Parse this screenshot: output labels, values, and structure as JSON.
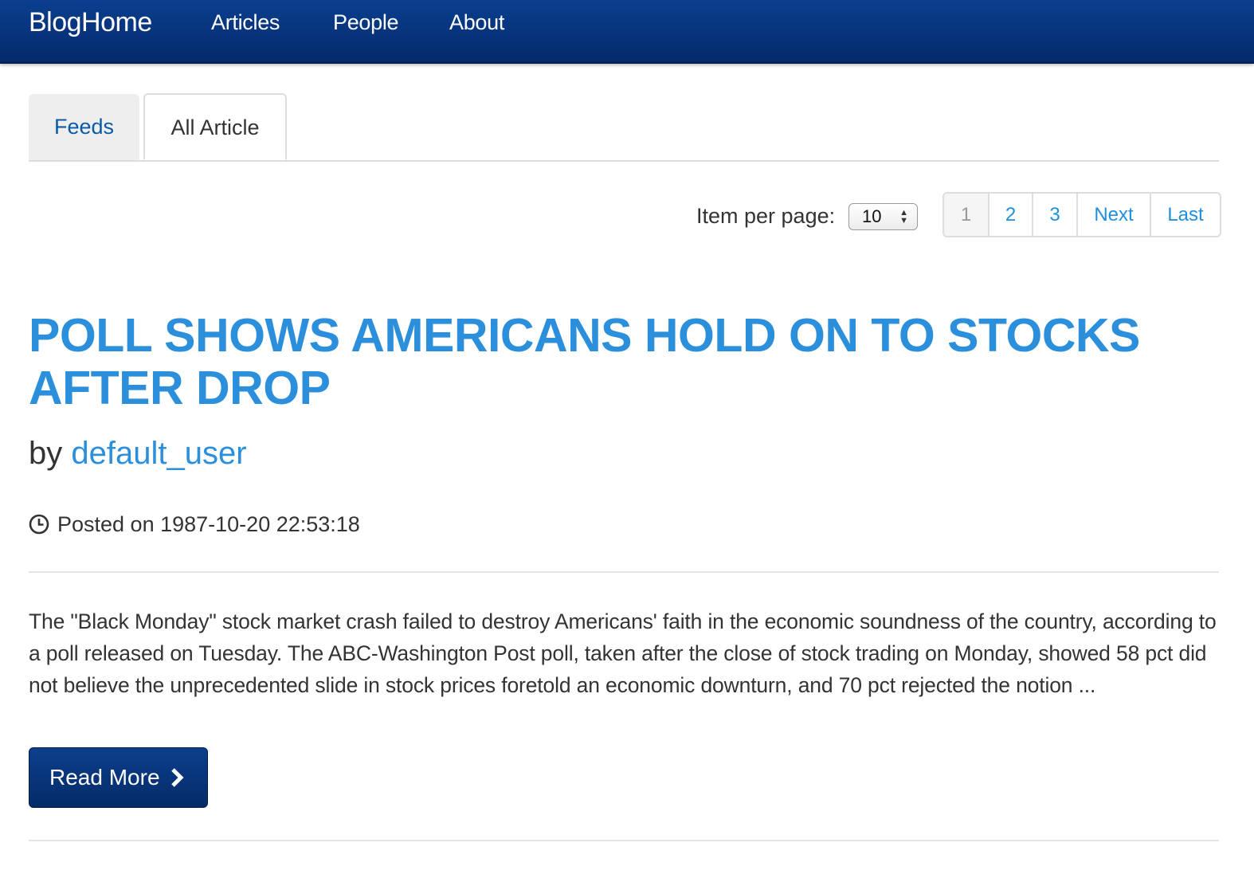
{
  "navbar": {
    "brand": "BlogHome",
    "links": [
      "Articles",
      "People",
      "About"
    ]
  },
  "tabs": [
    {
      "label": "Feeds",
      "active": false
    },
    {
      "label": "All Article",
      "active": true
    }
  ],
  "pagination": {
    "items_per_page_label": "Item per page:",
    "items_per_page_value": "10",
    "pages": [
      "1",
      "2",
      "3"
    ],
    "current_page": "1",
    "next_label": "Next",
    "last_label": "Last"
  },
  "article": {
    "title": "POLL SHOWS AMERICANS HOLD ON TO STOCKS AFTER DROP",
    "by_prefix": "by",
    "author": "default_user",
    "posted_label": "Posted on 1987-10-20 22:53:18",
    "summary": "The \"Black Monday\" stock market crash failed to destroy Americans' faith in the economic soundness of the country, according to a poll released on Tuesday. The ABC-Washington Post poll, taken after the close of stock trading on Monday, showed 58 pct did not believe the unprecedented slide in stock prices foretold an economic downturn, and 70 pct rejected the notion ...",
    "read_more_label": "Read More",
    "read_more_icon": "chevron-right-icon",
    "posted_icon": "clock-icon"
  },
  "colors": {
    "navbar": "#042a6b",
    "link": "#2b8fdc",
    "button": "#0c3f8c"
  }
}
